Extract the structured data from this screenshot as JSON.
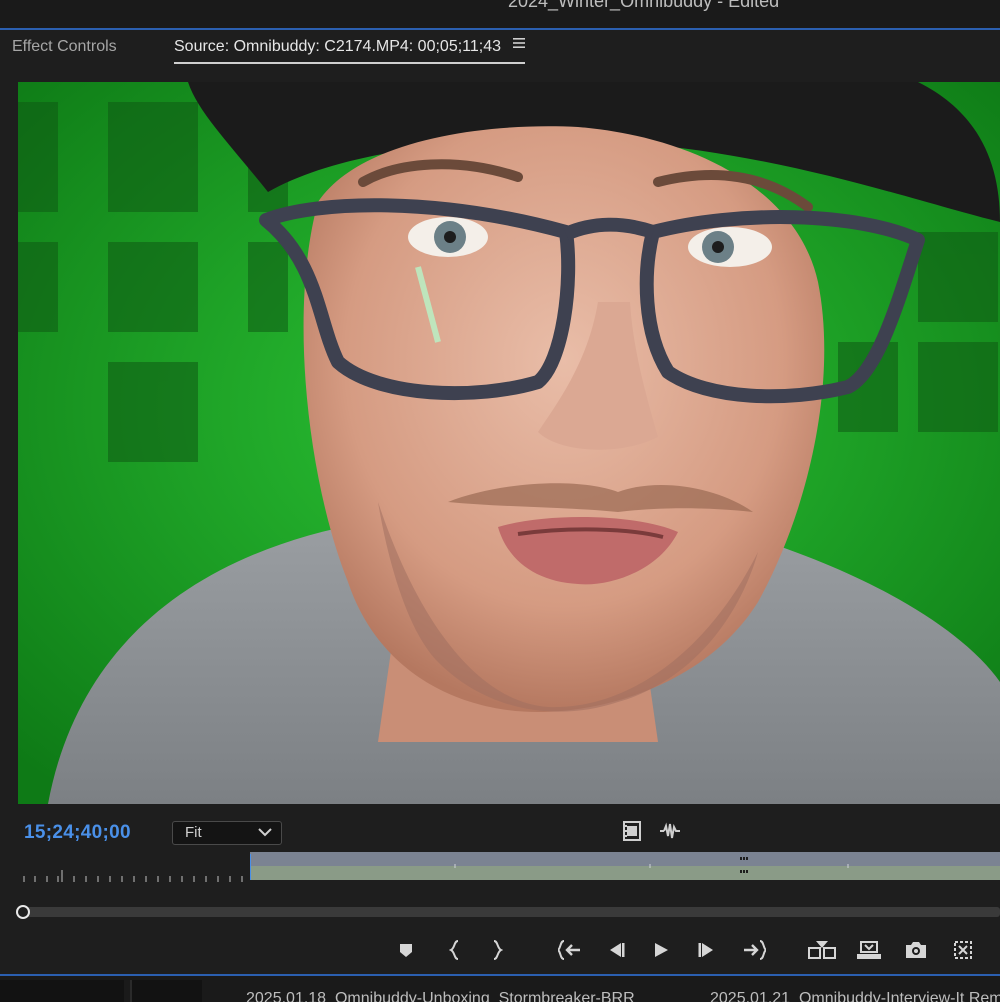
{
  "window": {
    "title": "2024_Winter_Omnibuddy - Edited"
  },
  "tabs": {
    "effect_controls": "Effect Controls",
    "source": "Source: Omnibuddy: C2174.MP4: 00;05;11;43",
    "menu_icon": "hamburger-menu-icon"
  },
  "viewer": {
    "content": "video-frame",
    "background_color": "#1fa82a"
  },
  "controls": {
    "timecode": "15;24;40;00",
    "timecode_color": "#4a90e8",
    "zoom_select": {
      "value": "Fit"
    },
    "icons": [
      "drag-video-only-icon",
      "drag-audio-only-icon"
    ]
  },
  "transport": {
    "buttons": [
      "add-marker-icon",
      "mark-in-icon",
      "mark-out-icon",
      "go-to-in-icon",
      "step-back-icon",
      "play-icon",
      "step-forward-icon",
      "go-to-out-icon",
      "insert-icon",
      "overwrite-icon",
      "export-frame-icon",
      "button-editor-icon"
    ]
  },
  "bottom_bar": {
    "clips": [
      "2025.01.18_Omnibuddy-Unboxing_Stormbreaker-BRR",
      "2025.01.21_Omnibuddy-Interview-It Rem"
    ]
  },
  "accent_color": "#2b5fb0"
}
